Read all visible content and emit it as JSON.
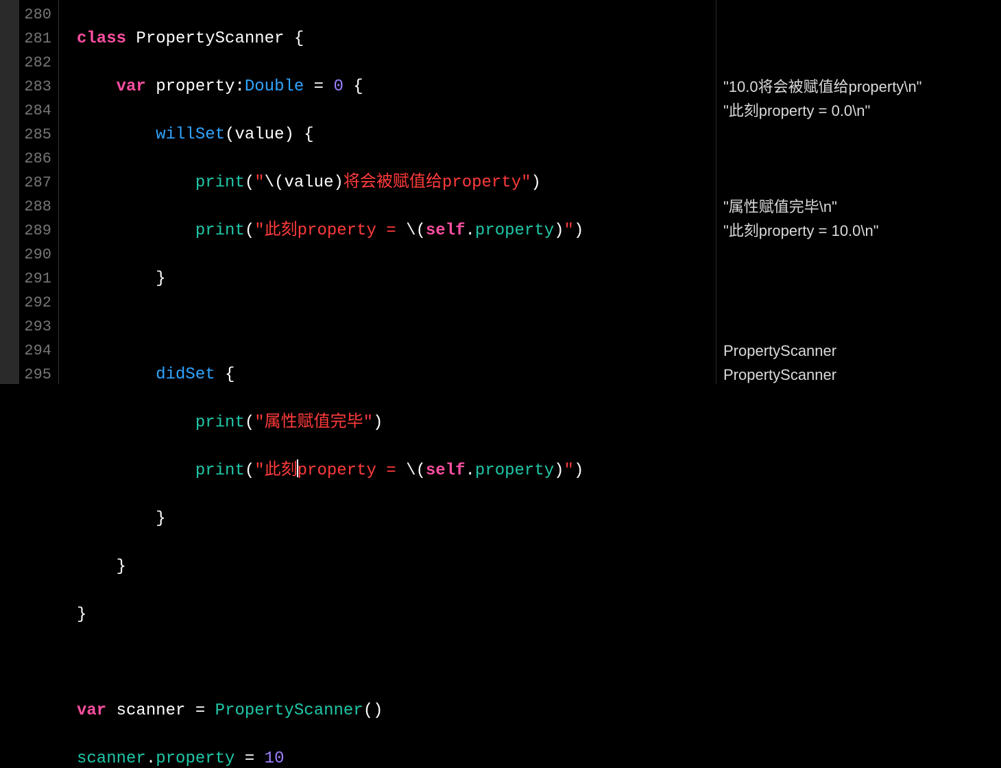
{
  "lineNumbers": [
    "280",
    "281",
    "282",
    "283",
    "284",
    "285",
    "286",
    "287",
    "288",
    "289",
    "290",
    "291",
    "292",
    "293",
    "294",
    "295"
  ],
  "code": {
    "l280": {
      "class_kw": "class",
      "class_name": "PropertyScanner",
      "brace": " {"
    },
    "l281": {
      "var_kw": "var",
      "prop": "property",
      "colon": ":",
      "type": "Double",
      "eq": " = ",
      "num": "0",
      "brace": " {"
    },
    "l282": {
      "willset": "willSet",
      "open": "(",
      "arg": "value",
      "close": ") {"
    },
    "l283": {
      "fn": "print",
      "open": "(",
      "q1": "\"",
      "esc1": "\\(",
      "val": "value",
      "esc2": ")",
      "txt": "将会被赋值给property",
      "q2": "\"",
      "close": ")"
    },
    "l284": {
      "fn": "print",
      "open": "(",
      "q1": "\"",
      "txt1": "此刻property = ",
      "esc1": "\\(",
      "self": "self",
      "dot": ".",
      "prop": "property",
      "esc2": ")",
      "q2": "\"",
      "close": ")"
    },
    "l285": {
      "brace": "}"
    },
    "l287": {
      "didset": "didSet",
      "brace": " {"
    },
    "l288": {
      "fn": "print",
      "open": "(",
      "q1": "\"",
      "txt": "属性赋值完毕",
      "q2": "\"",
      "close": ")"
    },
    "l289": {
      "fn": "print",
      "open": "(",
      "q1": "\"",
      "txt1": "此刻",
      "txt2": "property = ",
      "esc1": "\\(",
      "self": "self",
      "dot": ".",
      "prop": "property",
      "esc2": ")",
      "q2": "\"",
      "close": ")"
    },
    "l290": {
      "brace": "}"
    },
    "l291": {
      "brace": "}"
    },
    "l292": {
      "brace": "}"
    },
    "l294": {
      "var_kw": "var",
      "name": "scanner",
      "eq": " = ",
      "ctor": "PropertyScanner",
      "parens": "()"
    },
    "l295": {
      "obj": "scanner",
      "dot": ".",
      "prop": "property",
      "eq": " = ",
      "num": "10"
    }
  },
  "results": {
    "r283": "\"10.0将会被赋值给property\\n\"",
    "r284": "\"此刻property = 0.0\\n\"",
    "r288": "\"属性赋值完毕\\n\"",
    "r289": "\"此刻property = 10.0\\n\"",
    "r294": "PropertyScanner",
    "r295": "PropertyScanner"
  }
}
